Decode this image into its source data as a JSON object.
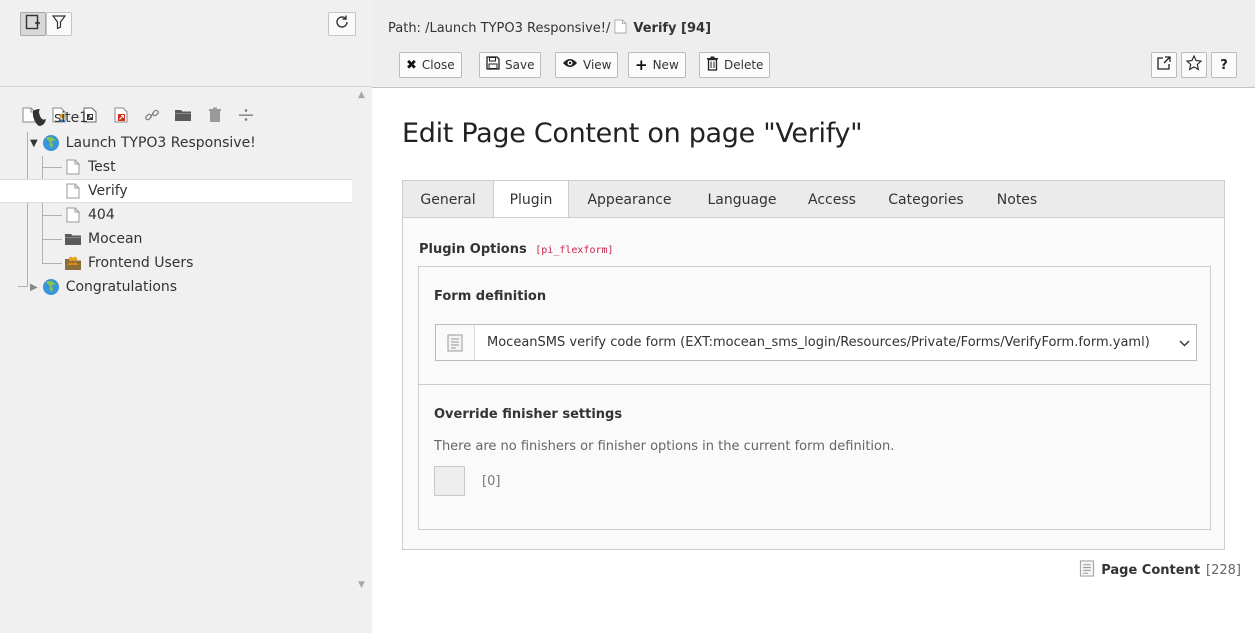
{
  "nav": {
    "new_page_icon": "page-new-icon",
    "filter_icon": "filter-icon",
    "refresh_icon": "refresh-icon",
    "new_item_icons": [
      "page-icon",
      "backend-user-page-icon",
      "shortcut-page-icon",
      "external-link-page-icon",
      "link-icon",
      "folder-icon",
      "recycler-icon",
      "menu-separator-icon"
    ]
  },
  "tree": {
    "root": "site1",
    "nodes": [
      {
        "label": "Launch TYPO3 Responsive!",
        "icon": "globe-icon",
        "expanded": true
      },
      {
        "label": "Test",
        "icon": "page-icon"
      },
      {
        "label": "Verify",
        "icon": "page-icon",
        "selected": true
      },
      {
        "label": "404",
        "icon": "page-icon"
      },
      {
        "label": "Mocean",
        "icon": "folder-icon"
      },
      {
        "label": "Frontend Users",
        "icon": "users-folder-icon"
      },
      {
        "label": "Congratulations",
        "icon": "globe-icon",
        "expanded": false
      }
    ]
  },
  "header": {
    "path_prefix": "Path: /Launch TYPO3 Responsive!/",
    "record_title": "Verify [94]",
    "buttons": {
      "close": "Close",
      "save": "Save",
      "view": "View",
      "new": "New",
      "delete": "Delete"
    },
    "help_label": "?"
  },
  "main": {
    "title": "Edit Page Content on page \"Verify\"",
    "tabs": [
      "General",
      "Plugin",
      "Appearance",
      "Language",
      "Access",
      "Categories",
      "Notes"
    ],
    "active_tab": "Plugin",
    "plugin_options_label": "Plugin Options",
    "plugin_options_code": "[pi_flexform]",
    "form_definition": {
      "label": "Form definition",
      "selected": "MoceanSMS verify code form (EXT:mocean_sms_login/Resources/Private/Forms/VerifyForm.form.yaml)"
    },
    "override": {
      "label": "Override finisher settings",
      "description": "There are no finishers or finisher options in the current form definition.",
      "value": "[0]"
    },
    "footer": {
      "record_type": "Page Content",
      "uid": "[228]"
    }
  }
}
